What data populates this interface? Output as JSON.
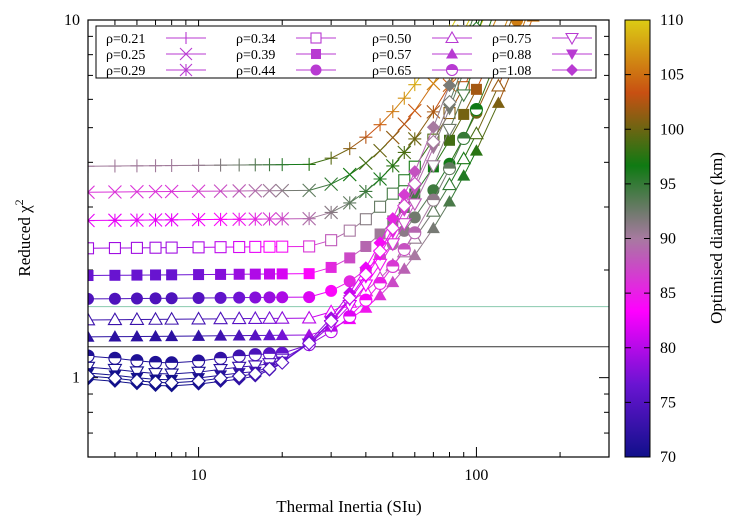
{
  "chart_data": {
    "type": "line",
    "xlabel": "Thermal Inertia (SIu)",
    "ylabel": "Reduced χ",
    "ylabel_superscript": "2",
    "x_scale": "log",
    "y_scale": "log",
    "xlim": [
      4,
      300
    ],
    "ylim": [
      0.6,
      10
    ],
    "x_ticks": [
      {
        "v": 10,
        "label": "10"
      },
      {
        "v": 100,
        "label": "100"
      }
    ],
    "y_ticks": [
      {
        "v": 1,
        "label": "1"
      },
      {
        "v": 10,
        "label": "10"
      }
    ],
    "reference_lines": [
      {
        "y": 1.58,
        "color": "#8ac9ae"
      },
      {
        "y": 1.22,
        "color": "#333333"
      }
    ],
    "x": [
      4,
      5,
      6,
      7,
      8,
      10,
      12,
      14,
      16,
      18,
      20,
      25,
      30,
      35,
      40,
      45,
      50,
      55,
      60,
      70,
      80,
      90,
      100,
      120,
      140,
      160,
      180,
      200
    ],
    "colorbar": {
      "label": "Optimised diameter (km)",
      "min": 70,
      "max": 110,
      "ticks": [
        70,
        75,
        80,
        85,
        90,
        95,
        100,
        105,
        110
      ],
      "stops": [
        "#10108a",
        "#6a14d2",
        "#ff00ff",
        "#a77aa0",
        "#0f7a13",
        "#c85012",
        "#dccc14"
      ]
    },
    "series": [
      {
        "name": "ρ=0.21",
        "marker": "plus",
        "base": 3.9,
        "knee": 25,
        "slope": 1.35
      },
      {
        "name": "ρ=0.25",
        "marker": "cross",
        "base": 3.3,
        "knee": 25,
        "slope": 1.35
      },
      {
        "name": "ρ=0.29",
        "marker": "star",
        "base": 2.75,
        "knee": 25,
        "slope": 1.35
      },
      {
        "name": "ρ=0.34",
        "marker": "square-open",
        "base": 2.3,
        "knee": 25,
        "slope": 1.35
      },
      {
        "name": "ρ=0.39",
        "marker": "square",
        "base": 1.93,
        "knee": 25,
        "slope": 1.35
      },
      {
        "name": "ρ=0.44",
        "marker": "circle",
        "base": 1.66,
        "knee": 25,
        "slope": 1.35
      },
      {
        "name": "ρ=0.50",
        "marker": "triangle-open",
        "base": 1.45,
        "knee": 25,
        "slope": 1.35
      },
      {
        "name": "ρ=0.57",
        "marker": "triangle",
        "base": 1.3,
        "knee": 25,
        "slope": 1.35
      },
      {
        "name": "ρ=0.65",
        "marker": "circle-half",
        "base": 1.16,
        "knee": 20,
        "slope": 1.35
      },
      {
        "name": "ρ=0.75",
        "marker": "triangle-down-open",
        "base": 1.08,
        "knee": 17,
        "slope": 1.4
      },
      {
        "name": "ρ=0.88",
        "marker": "triangle-down",
        "base": 1.04,
        "knee": 16,
        "slope": 1.45
      },
      {
        "name": "ρ=1.08",
        "marker": "diamond",
        "base": 1.0,
        "knee": 15,
        "slope": 1.5
      }
    ],
    "series_extra": [
      {
        "name": "",
        "marker": "diamond-open",
        "base": 1.02,
        "knee": 15.5,
        "slope": 1.45
      }
    ]
  }
}
